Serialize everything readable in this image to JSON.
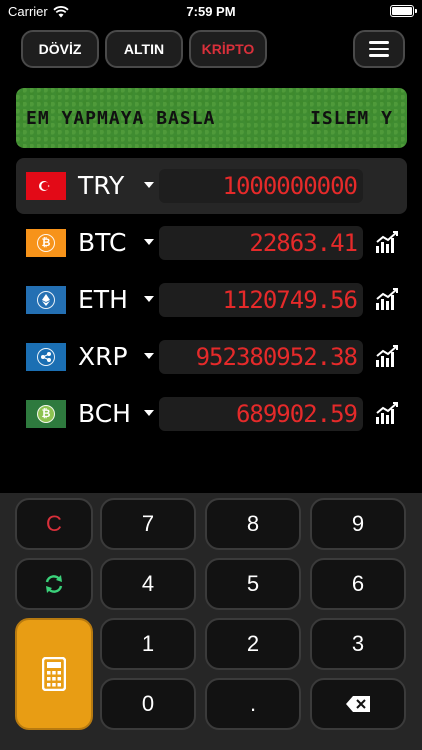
{
  "status": {
    "carrier": "Carrier",
    "time": "7:59 PM"
  },
  "tabs": [
    {
      "label": "DÖVİZ",
      "active": false
    },
    {
      "label": "ALTIN",
      "active": false
    },
    {
      "label": "KRİPTO",
      "active": true
    }
  ],
  "banner": {
    "text": "EM YAPMAYA BASLA        ISLEM Y"
  },
  "rows": [
    {
      "code": "TRY",
      "icon": "turkey-flag-icon",
      "value": "1000000000",
      "selected": true
    },
    {
      "code": "BTC",
      "icon": "bitcoin-icon",
      "value": "22863.41",
      "selected": false
    },
    {
      "code": "ETH",
      "icon": "ethereum-icon",
      "value": "1120749.56",
      "selected": false
    },
    {
      "code": "XRP",
      "icon": "ripple-icon",
      "value": "952380952.38",
      "selected": false
    },
    {
      "code": "BCH",
      "icon": "bitcoin-cash-icon",
      "value": "689902.59",
      "selected": false
    }
  ],
  "keys": {
    "clear": "C",
    "k7": "7",
    "k8": "8",
    "k9": "9",
    "k4": "4",
    "k5": "5",
    "k6": "6",
    "k1": "1",
    "k2": "2",
    "k3": "3",
    "k0": "0",
    "dot": "."
  },
  "colors": {
    "accent_red": "#e52a2a",
    "calc_orange": "#e89d14",
    "banner_green": "#3f8c31"
  }
}
